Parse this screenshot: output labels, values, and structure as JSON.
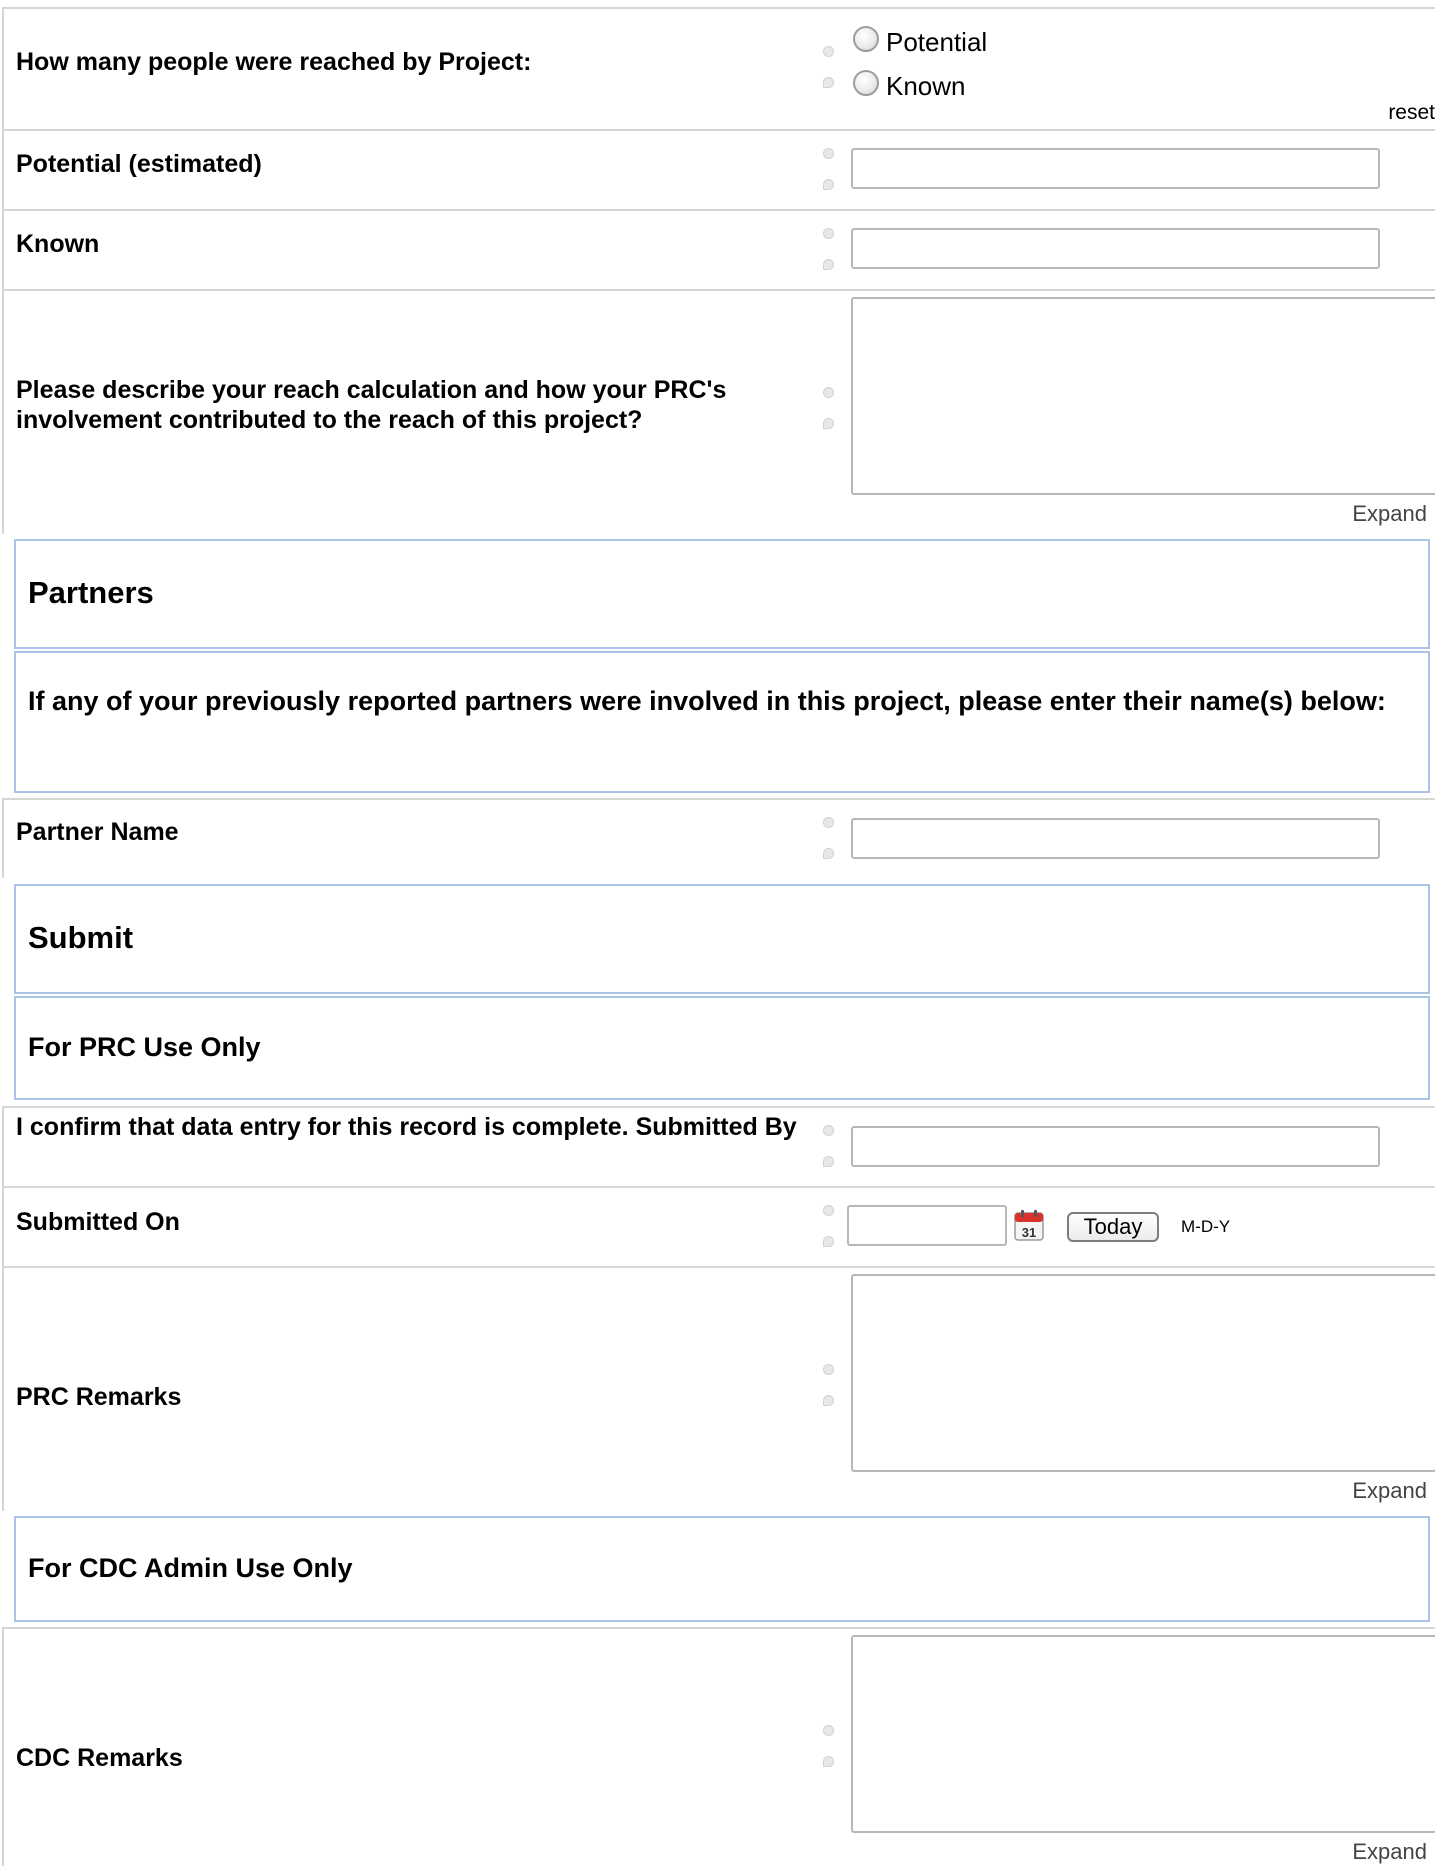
{
  "reach": {
    "question": "How many people were reached by Project:",
    "options": [
      "Potential",
      "Known"
    ],
    "reset_label": "reset"
  },
  "fields": {
    "potential_label": "Potential (estimated)",
    "known_label": "Known",
    "reach_description_label": "Please describe your reach calculation and how your PRC's involvement contributed to the reach of this project?",
    "partner_name_label": "Partner Name",
    "submitted_by_label": "I confirm that data entry for this record is complete. Submitted By",
    "submitted_on_label": "Submitted On",
    "prc_remarks_label": "PRC Remarks",
    "cdc_remarks_label": "CDC Remarks"
  },
  "expand_label": "Expand",
  "sections": {
    "partners": "Partners",
    "partners_note": "If any of your previously reported partners were involved in this project, please enter their name(s) below:",
    "submit": "Submit",
    "prc_use_only": "For PRC Use Only",
    "cdc_admin_use_only": "For CDC Admin Use Only"
  },
  "date": {
    "calendar_day": "31",
    "today_label": "Today",
    "format_hint": "M-D-Y"
  },
  "colors": {
    "section_border": "#a9c3e6",
    "row_border": "#d6d6d6",
    "calendar_red": "#d9312b"
  },
  "icons": {
    "history": "history-icon",
    "comment": "comment-icon",
    "calendar": "calendar-icon"
  }
}
